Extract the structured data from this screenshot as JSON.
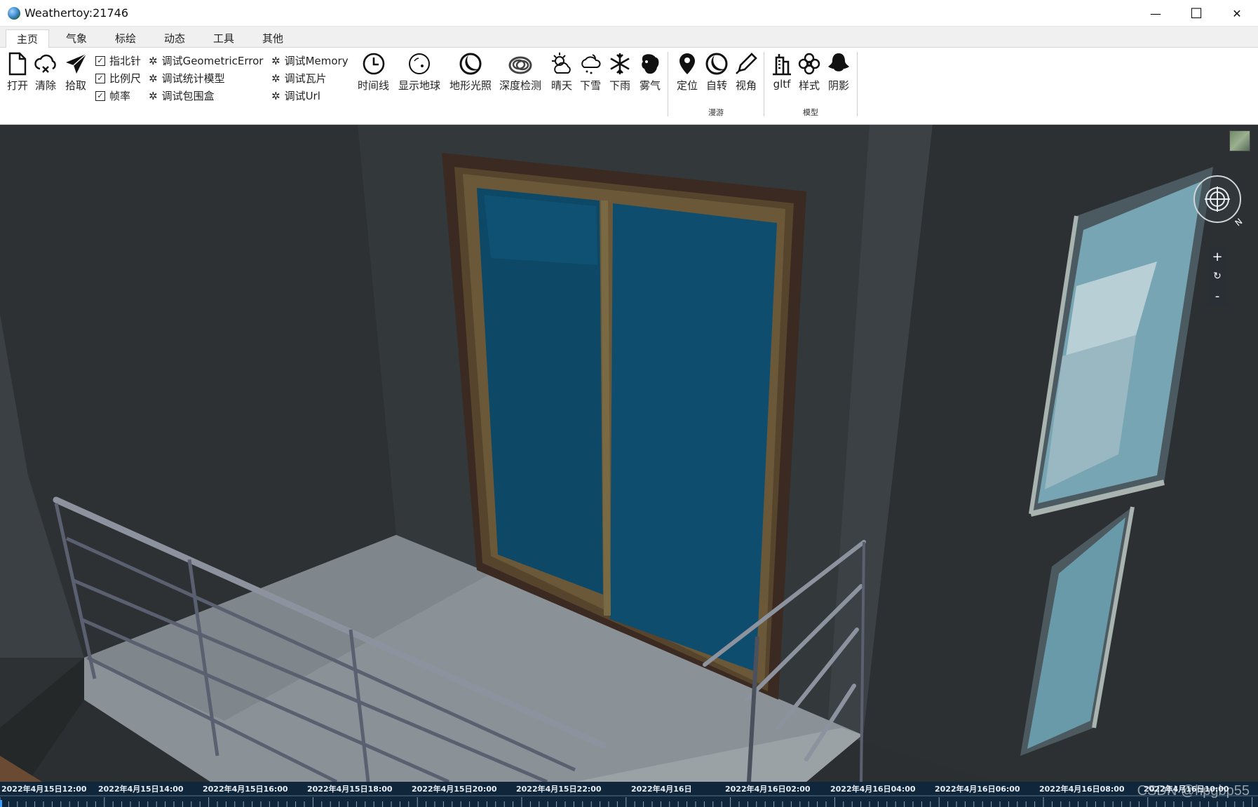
{
  "window": {
    "title": "Weathertoy:21746",
    "minimize_glyph": "—",
    "maximize_glyph": "☐",
    "close_glyph": "✕"
  },
  "tabs": [
    {
      "label": "主页",
      "active": true
    },
    {
      "label": "气象",
      "active": false
    },
    {
      "label": "标绘",
      "active": false
    },
    {
      "label": "动态",
      "active": false
    },
    {
      "label": "工具",
      "active": false
    },
    {
      "label": "其他",
      "active": false
    }
  ],
  "ribbon": {
    "file_buttons": [
      {
        "label": "打开",
        "icon": "file-icon"
      },
      {
        "label": "清除",
        "icon": "cloud-clear-icon"
      },
      {
        "label": "拾取",
        "icon": "pointer-icon"
      }
    ],
    "checkboxes": [
      {
        "label": "指北针",
        "checked": true
      },
      {
        "label": "比例尺",
        "checked": true
      },
      {
        "label": "帧率",
        "checked": true
      }
    ],
    "debug_col1": [
      "调试GeometricError",
      "调试统计模型",
      "调试包围盒"
    ],
    "debug_col2": [
      "调试Memory",
      "调试瓦片",
      "调试Url"
    ],
    "scene_buttons": [
      {
        "label": "时间线",
        "icon": "clock-icon"
      },
      {
        "label": "显示地球",
        "icon": "globe-icon"
      },
      {
        "label": "地形光照",
        "icon": "moon-icon"
      },
      {
        "label": "深度检测",
        "icon": "layers-cloud-icon"
      },
      {
        "label": "晴天",
        "icon": "sunny-icon"
      },
      {
        "label": "下雪",
        "icon": "snow-cloud-icon"
      },
      {
        "label": "下雨",
        "icon": "snowflake-icon"
      },
      {
        "label": "雾气",
        "icon": "fog-icon"
      }
    ],
    "roam_buttons": [
      {
        "label": "定位",
        "icon": "location-pin-icon"
      },
      {
        "label": "自转",
        "icon": "rotate-icon"
      },
      {
        "label": "视角",
        "icon": "view-angle-icon"
      }
    ],
    "roam_group_label": "漫游",
    "model_buttons": [
      {
        "label": "gltf",
        "icon": "building-icon"
      },
      {
        "label": "样式",
        "icon": "flower-style-icon"
      },
      {
        "label": "阴影",
        "icon": "ghost-shadow-icon"
      }
    ],
    "model_group_label": "模型"
  },
  "navigation": {
    "zoom_in": "+",
    "reset": "↻",
    "zoom_out": "-",
    "compass_north": "N"
  },
  "timeline": {
    "labels": [
      "2022年4月15日12:00",
      "2022年4月15日14:00",
      "2022年4月15日16:00",
      "2022年4月15日18:00",
      "2022年4月15日20:00",
      "2022年4月15日22:00",
      "2022年4月16日",
      "2022年4月16日02:00",
      "2022年4月16日04:00",
      "2022年4月16日06:00",
      "2022年4月16日08:00",
      "2022年4月16日10:00"
    ]
  },
  "watermark": "CSDN @hpgbp55",
  "colors": {
    "wall": "#2f3336",
    "glass": "#0f4d6e",
    "floor": "#8c9499",
    "frame": "#3a2b22",
    "timeline_bg": "#10263b"
  }
}
